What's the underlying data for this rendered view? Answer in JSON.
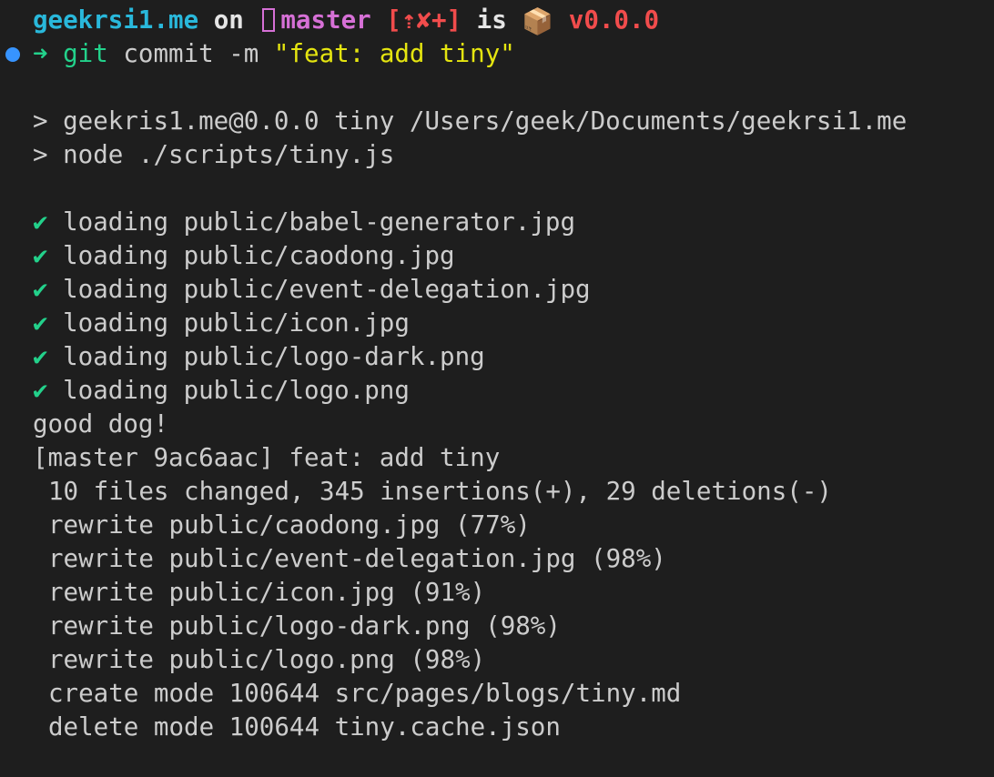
{
  "prompt": {
    "dir": "geekrsi1.me",
    "on": "on",
    "branch": "master",
    "git_status": "[⇡✘+]",
    "is": "is",
    "package_emoji": "📦",
    "version": "v0.0.0"
  },
  "command": {
    "arrow": "➜",
    "git": "git",
    "args": " commit -m ",
    "message": "\"feat: add tiny\""
  },
  "npm": {
    "line1": "> geekris1.me@0.0.0 tiny /Users/geek/Documents/geekrsi1.me",
    "line2": "> node ./scripts/tiny.js"
  },
  "check_mark": "✔",
  "loading": [
    " loading public/babel-generator.jpg",
    " loading public/caodong.jpg",
    " loading public/event-delegation.jpg",
    " loading public/icon.jpg",
    " loading public/logo-dark.png",
    " loading public/logo.png"
  ],
  "result": {
    "good": "good dog!",
    "commit": "[master 9ac6aac] feat: add tiny",
    "summary": "10 files changed, 345 insertions(+), 29 deletions(-)",
    "changes": [
      "rewrite public/caodong.jpg (77%)",
      "rewrite public/event-delegation.jpg (98%)",
      "rewrite public/icon.jpg (91%)",
      "rewrite public/logo-dark.png (98%)",
      "rewrite public/logo.png (98%)",
      "create mode 100644 src/pages/blogs/tiny.md",
      "delete mode 100644 tiny.cache.json"
    ]
  },
  "colors": {
    "background": "#1e1e1e",
    "text": "#cccccc",
    "cyan": "#29b8db",
    "magenta": "#d670d6",
    "red": "#f14c4c",
    "green": "#23d18b",
    "yellow": "#e5e510",
    "blue_dot": "#3794ff"
  }
}
